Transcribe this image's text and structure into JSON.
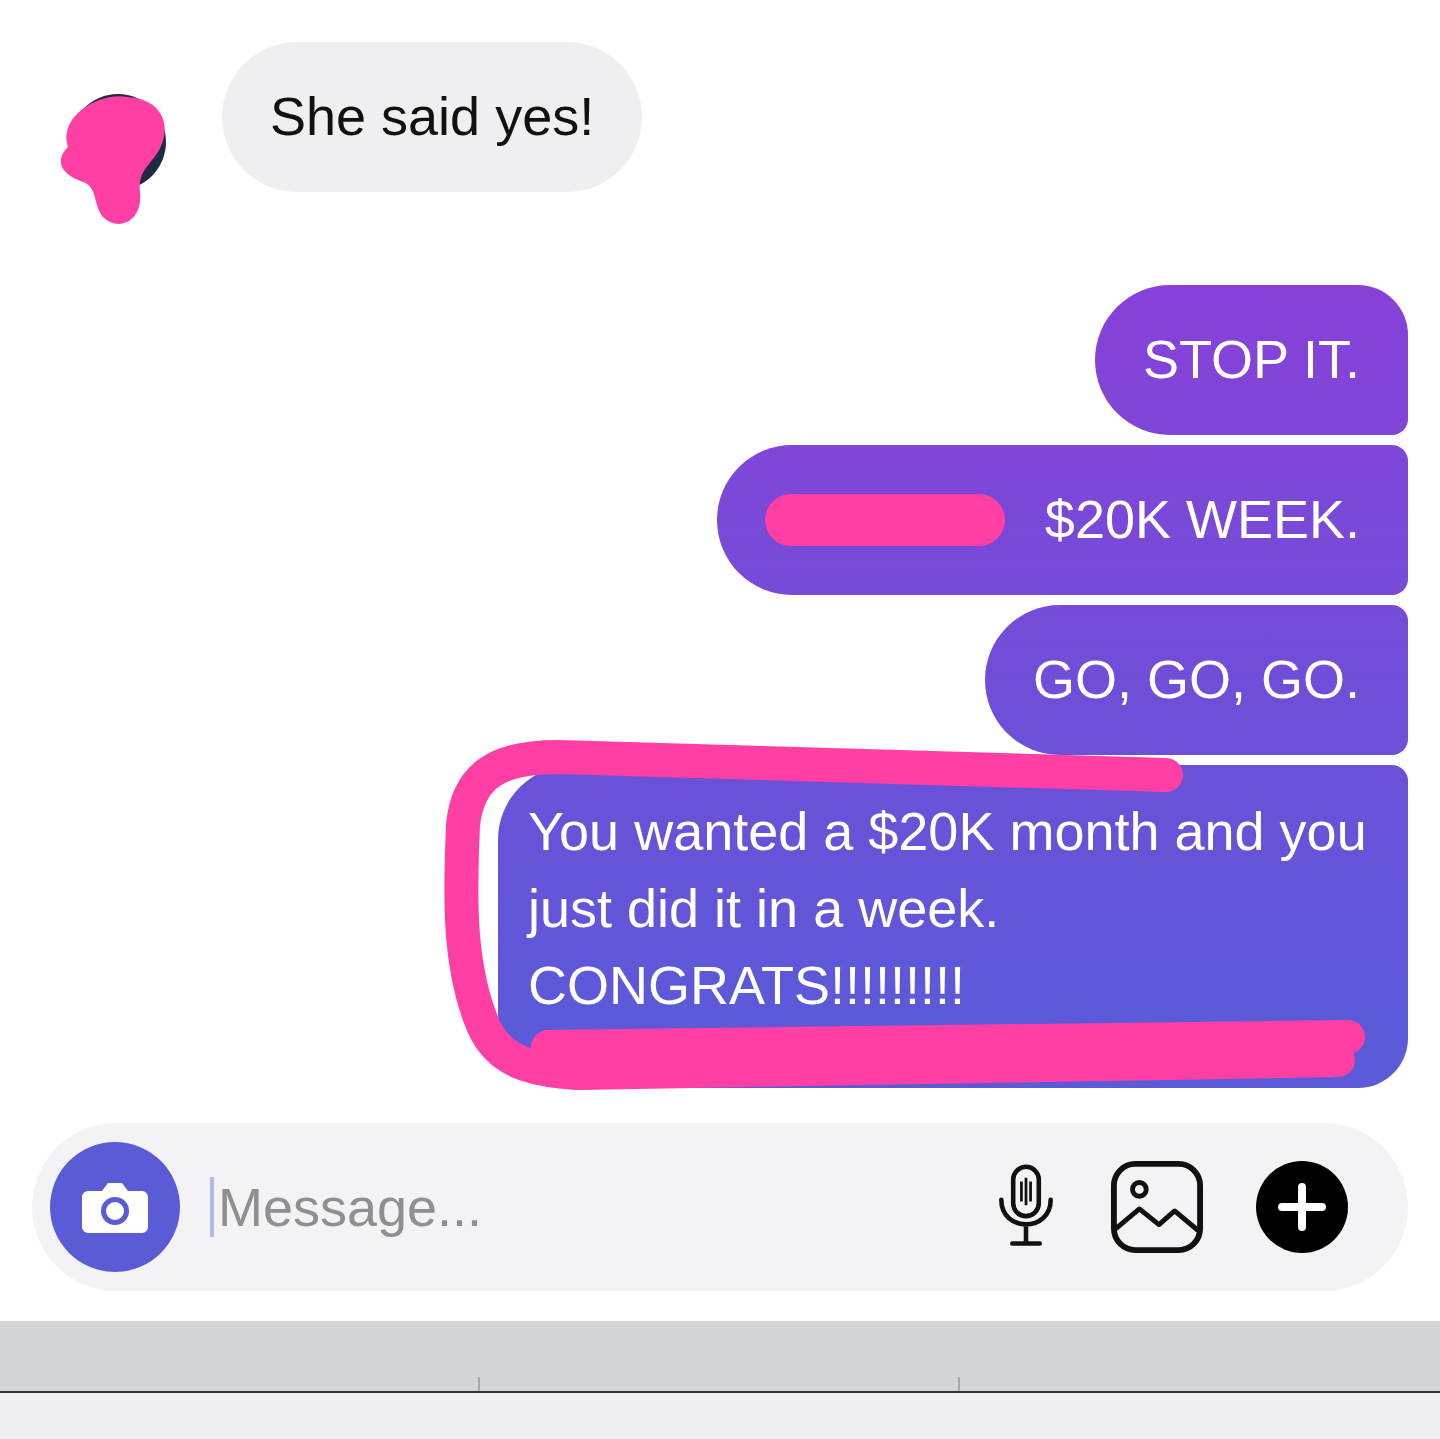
{
  "contact": {
    "avatar_redacted": true
  },
  "messages": [
    {
      "kind": "incoming",
      "text": "She said yes!",
      "redacted": false,
      "outlined": false
    },
    {
      "kind": "outgoing",
      "text": "STOP IT.",
      "redacted": false,
      "outlined": false
    },
    {
      "kind": "outgoing",
      "text": "$20K WEEK.",
      "redacted": true,
      "outlined": false
    },
    {
      "kind": "outgoing",
      "text": "GO, GO, GO.",
      "redacted": false,
      "outlined": false
    },
    {
      "kind": "outgoing",
      "text": "You wanted a $20K month and you just did it in a week. CONGRATS!!!!!!!!!",
      "redacted": false,
      "outlined": true
    }
  ],
  "composer": {
    "placeholder": "Message..."
  }
}
